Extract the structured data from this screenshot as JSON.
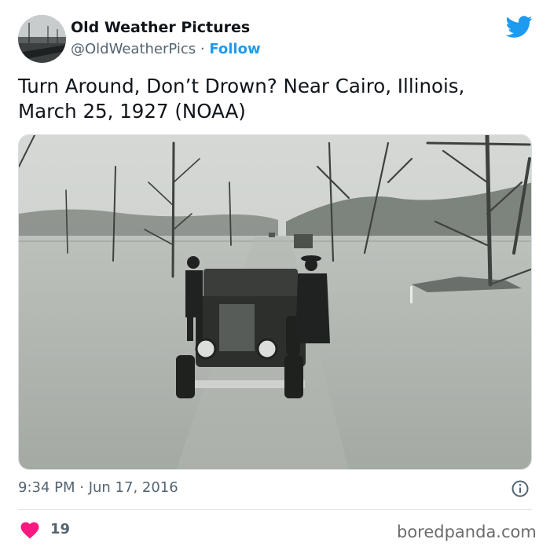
{
  "user": {
    "name": "Old Weather Pictures",
    "handle": "@OldWeatherPics",
    "separator": "·",
    "follow_label": "Follow"
  },
  "tweet": {
    "text": "Turn Around, Don’t Drown? Near Cairo, Illinois, March 25, 1927 (NOAA)"
  },
  "meta": {
    "timestamp": "9:34 PM · Jun 17, 2016"
  },
  "engagement": {
    "likes": "19"
  },
  "watermark": "boredpanda.com",
  "icons": {
    "platform": "twitter-bird-icon",
    "info": "info-icon",
    "like": "heart-icon"
  },
  "colors": {
    "twitter_blue": "#1d9bf0",
    "like_red": "#f91880",
    "secondary_text": "#536471"
  }
}
